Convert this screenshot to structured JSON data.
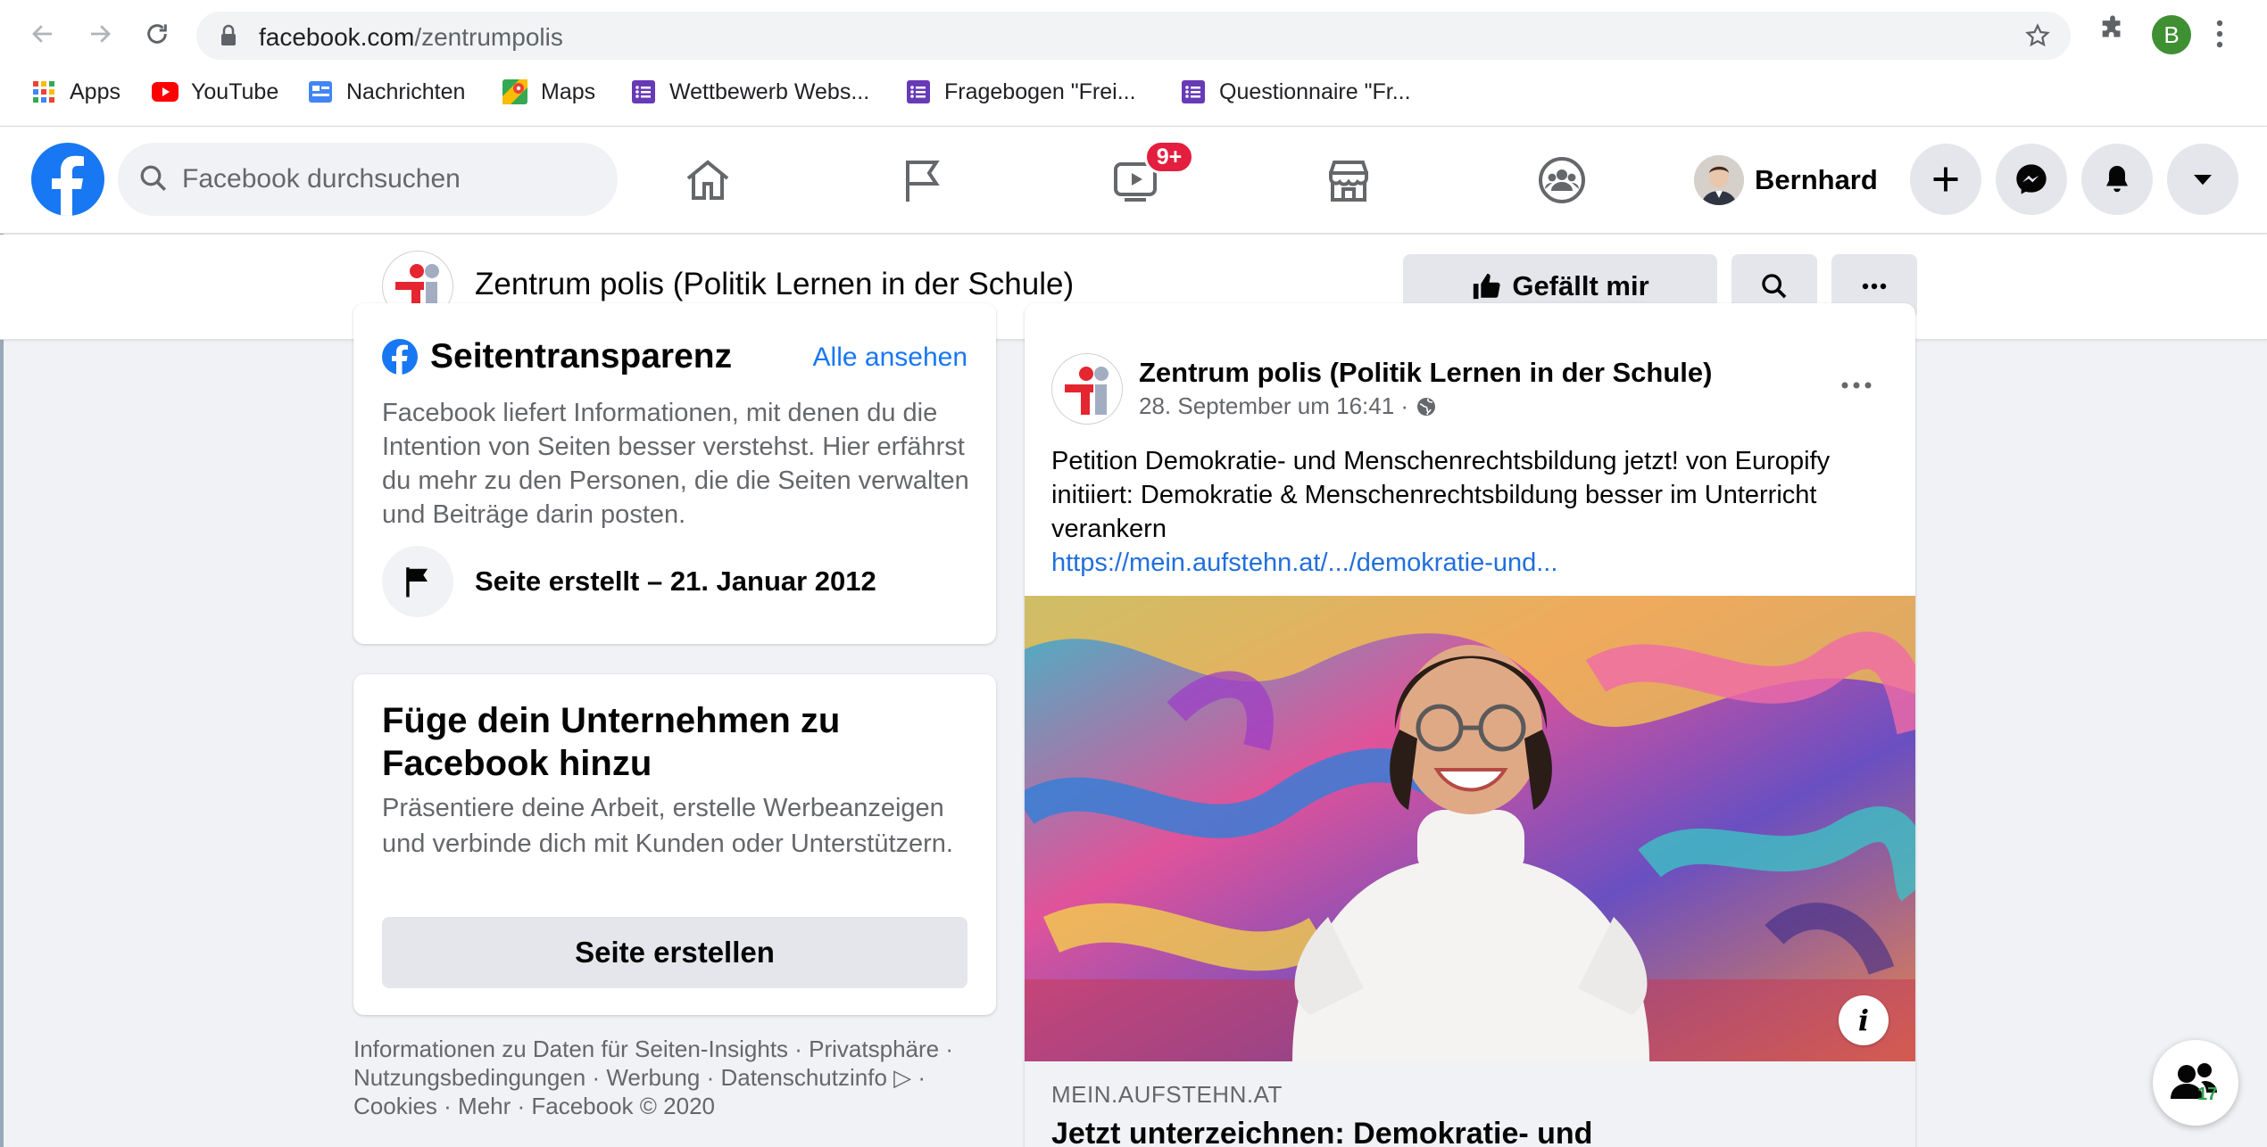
{
  "browser": {
    "url_domain": "facebook.com",
    "url_path": "/zentrumpolis",
    "profile_initial": "B",
    "bookmarks": [
      {
        "label": "Apps",
        "icon": "apps-grid-icon"
      },
      {
        "label": "YouTube",
        "icon": "youtube-icon"
      },
      {
        "label": "Nachrichten",
        "icon": "google-news-icon"
      },
      {
        "label": "Maps",
        "icon": "maps-icon"
      },
      {
        "label": "Wettbewerb Webs...",
        "icon": "forms-icon"
      },
      {
        "label": "Fragebogen \"Frei...",
        "icon": "forms-icon"
      },
      {
        "label": "Questionnaire \"Fr...",
        "icon": "forms-icon"
      }
    ]
  },
  "fb_header": {
    "search_placeholder": "Facebook durchsuchen",
    "watch_badge": "9+",
    "user_name": "Bernhard"
  },
  "page": {
    "title": "Zentrum polis (Politik Lernen in der Schule)",
    "like_label": "Gefällt mir"
  },
  "transparency": {
    "title": "Seitentransparenz",
    "see_all": "Alle ansehen",
    "description": "Facebook liefert Informationen, mit denen du die Intention von Seiten besser verstehst. Hier erfährst du mehr zu den Personen, die die Seiten verwalten und Beiträge darin posten.",
    "created": "Seite erstellt – 21. Januar 2012"
  },
  "business": {
    "title": "Füge dein Unternehmen zu Facebook hinzu",
    "description": "Präsentiere deine Arbeit, erstelle Werbeanzeigen und verbinde dich mit Kunden oder Unterstützern.",
    "button": "Seite erstellen"
  },
  "footer": {
    "line1": "Informationen zu Daten für Seiten-Insights · Privatsphäre ·",
    "line2": "Nutzungsbedingungen · Werbung · Datenschutzinfo ▷ ·",
    "line3": "Cookies · Mehr · Facebook © 2020"
  },
  "post": {
    "author": "Zentrum polis (Politik Lernen in der Schule)",
    "timestamp": "28. September um 16:41 ·",
    "text": "Petition Demokratie- und Menschenrechtsbildung jetzt! von Europify initiiert: Demokratie & Menschenrechtsbildung besser im Unterricht verankern",
    "link": "https://mein.aufstehn.at/.../demokratie-und...",
    "preview_domain": "MEIN.AUFSTEHN.AT",
    "preview_title": "Jetzt unterzeichnen: Demokratie- und"
  },
  "contacts": {
    "count": "17"
  },
  "colors": {
    "facebook_blue": "#1877f2",
    "badge_red": "#e41e3f",
    "link_blue": "#216fdb",
    "online_green": "#31a24c"
  }
}
